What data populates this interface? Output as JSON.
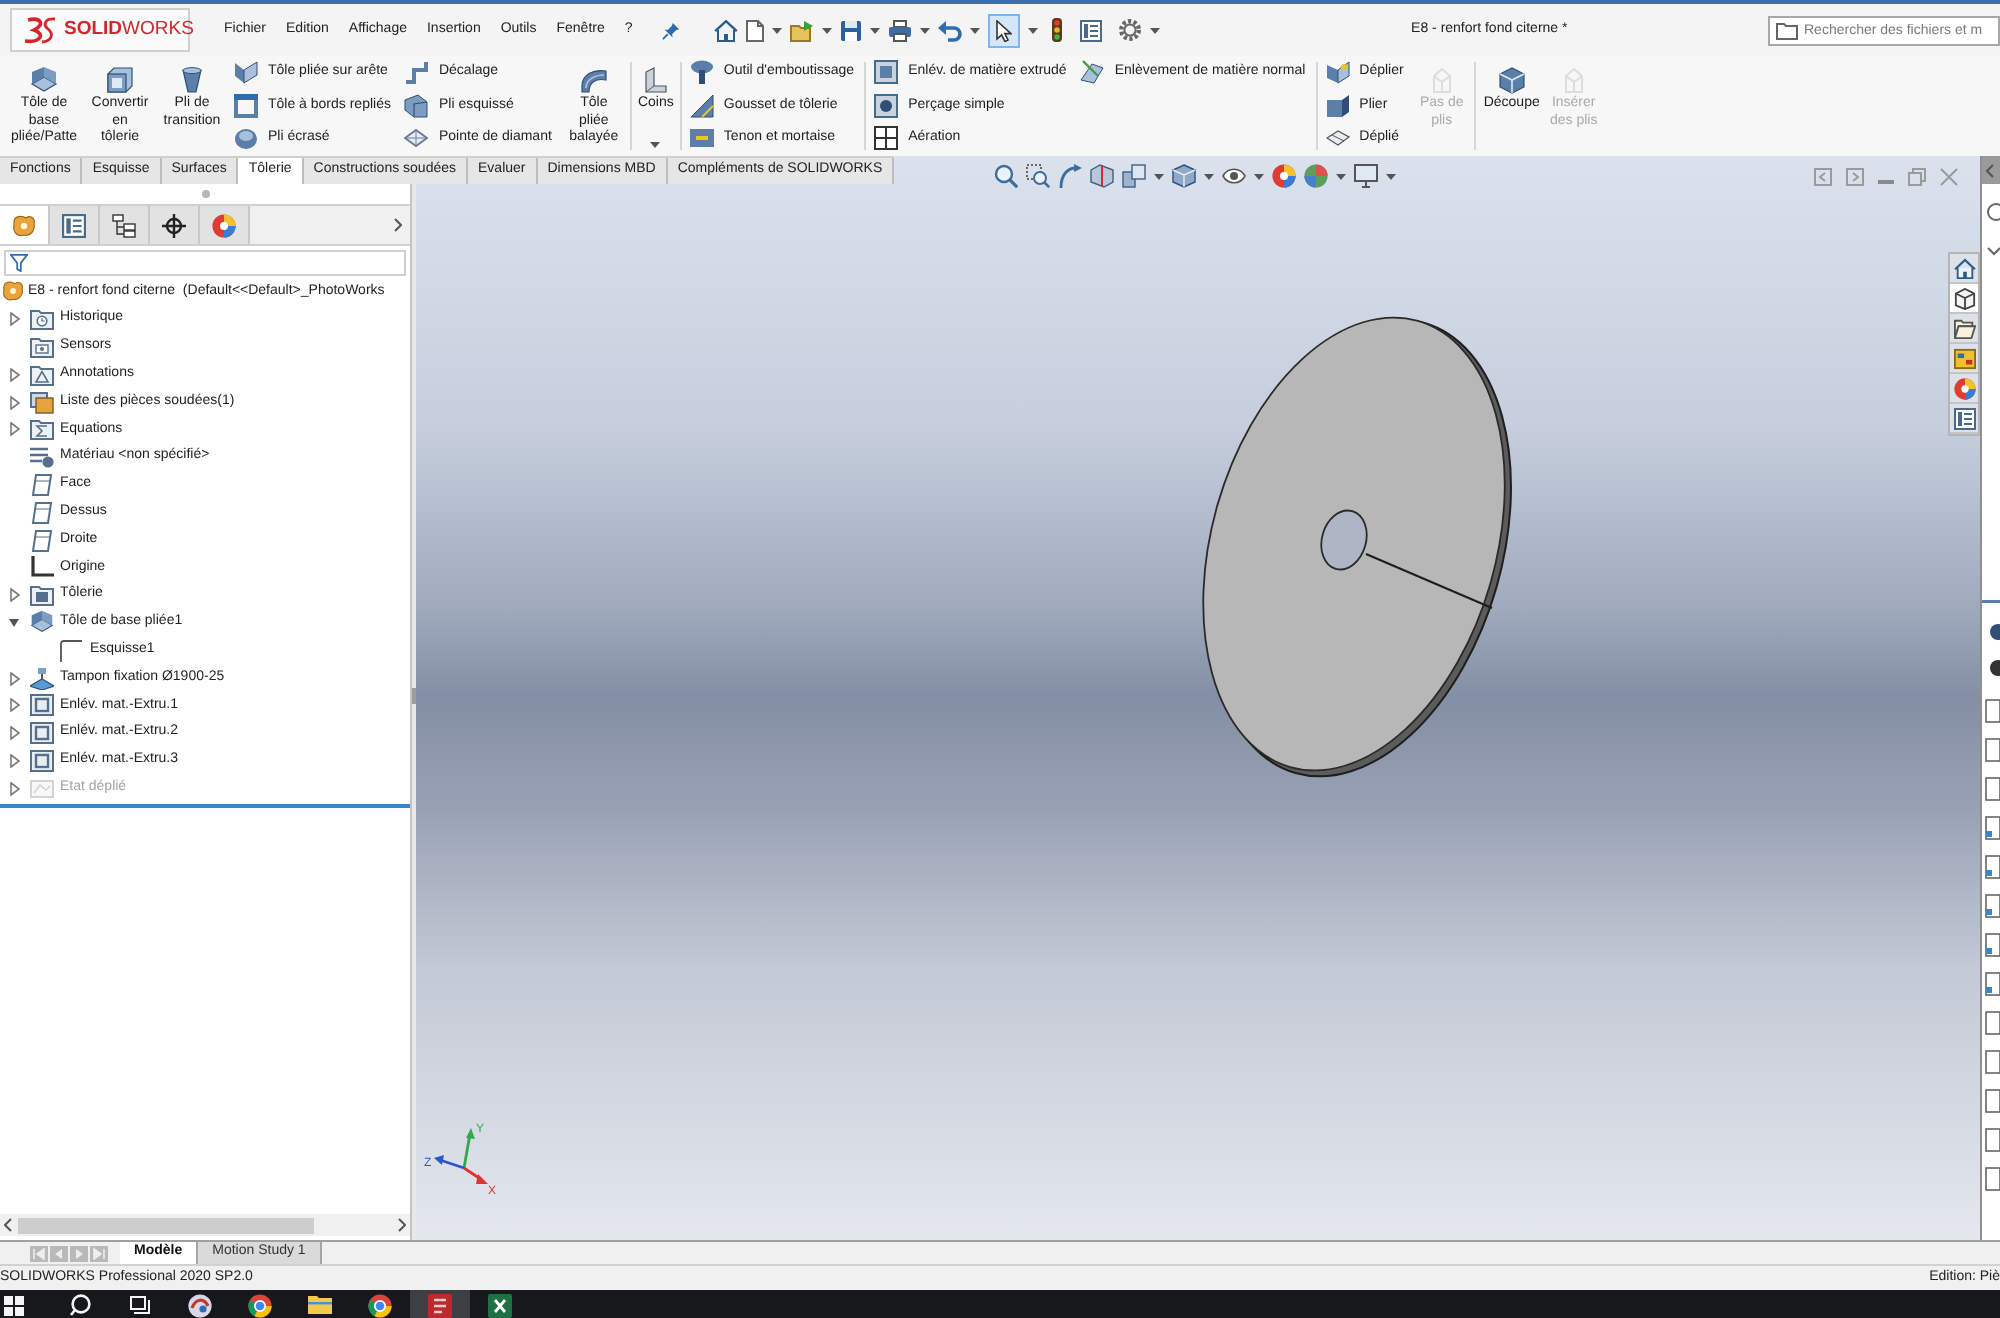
{
  "title_bar": {
    "logo": "**SOLID**WORKS",
    "menu": [
      "Fichier",
      "Edition",
      "Affichage",
      "Insertion",
      "Outils",
      "Fenêtre",
      "?"
    ],
    "select_tool": {
      "active": true
    },
    "document_title": "E8 - renfort fond citerne *",
    "search": {
      "placeholder": "Rechercher des fichiers et m"
    }
  },
  "ribbon": [
    {
      "kind": "large",
      "label": "Tôle de\nbase\npliée/Patte",
      "disabled": false,
      "dropdown": false
    },
    {
      "kind": "large",
      "label": "Convertir\nen\ntôlerie",
      "disabled": false,
      "dropdown": false
    },
    {
      "kind": "large",
      "label": "Pli de\ntransition",
      "disabled": false,
      "dropdown": false
    },
    {
      "kind": "column",
      "items": [
        {
          "label": "Tôle pliée sur arête"
        },
        {
          "label": "Tôle à bords repliés"
        },
        {
          "label": "Pli écrasé"
        }
      ]
    },
    {
      "kind": "column",
      "items": [
        {
          "label": "Décalage"
        },
        {
          "label": "Pli esquissé"
        },
        {
          "label": "Pointe de diamant"
        }
      ]
    },
    {
      "kind": "large",
      "label": "Tôle\npliée\nbalayée",
      "disabled": false,
      "dropdown": false
    },
    {
      "kind": "separator"
    },
    {
      "kind": "large",
      "label": "Coins",
      "disabled": false,
      "dropdown": true
    },
    {
      "kind": "separator"
    },
    {
      "kind": "column",
      "items": [
        {
          "label": "Outil d'emboutissage"
        },
        {
          "label": "Gousset de tôlerie"
        },
        {
          "label": "Tenon et mortaise"
        }
      ]
    },
    {
      "kind": "separator"
    },
    {
      "kind": "column",
      "items": [
        {
          "label": "Enlév. de matière extrudé"
        },
        {
          "label": "Perçage simple"
        },
        {
          "label": "Aération"
        }
      ]
    },
    {
      "kind": "column",
      "items": [
        {
          "label": "Enlèvement de matière normal"
        }
      ]
    },
    {
      "kind": "separator"
    },
    {
      "kind": "column",
      "items": [
        {
          "label": "Déplier"
        },
        {
          "label": "Plier"
        },
        {
          "label": "Déplié"
        }
      ]
    },
    {
      "kind": "large",
      "label": "Pas de\nplis",
      "disabled": true,
      "dropdown": false
    },
    {
      "kind": "separator"
    },
    {
      "kind": "large",
      "label": "Découpe",
      "disabled": false,
      "dropdown": false
    },
    {
      "kind": "large",
      "label": "Insérer\ndes plis",
      "disabled": true,
      "dropdown": false
    }
  ],
  "command_tabs": [
    {
      "label": "Fonctions",
      "selected": false
    },
    {
      "label": "Esquisse",
      "selected": false
    },
    {
      "label": "Surfaces",
      "selected": false
    },
    {
      "label": "Tôlerie",
      "selected": true
    },
    {
      "label": "Constructions soudées",
      "selected": false
    },
    {
      "label": "Evaluer",
      "selected": false
    },
    {
      "label": "Dimensions MBD",
      "selected": false
    },
    {
      "label": "Compléments de SOLIDWORKS",
      "selected": false
    }
  ],
  "feature_manager": {
    "panel_tabs": [
      {
        "selected": true
      },
      {
        "selected": false
      },
      {
        "selected": false
      },
      {
        "selected": false
      },
      {
        "selected": false
      }
    ],
    "tree": {
      "root": "E8 - renfort fond citerne  (Default<<Default>_PhotoWorks",
      "items": [
        {
          "label": "Historique",
          "expanded": false,
          "suppressed": false
        },
        {
          "label": "Sensors",
          "suppressed": false
        },
        {
          "label": "Annotations",
          "expanded": false,
          "suppressed": false
        },
        {
          "label": "Liste des pièces soudées(1)",
          "expanded": false,
          "suppressed": false
        },
        {
          "label": "Equations",
          "expanded": false,
          "suppressed": false
        },
        {
          "label": "Matériau <non spécifié>",
          "suppressed": false
        },
        {
          "label": "Face",
          "suppressed": false
        },
        {
          "label": "Dessus",
          "suppressed": false
        },
        {
          "label": "Droite",
          "suppressed": false
        },
        {
          "label": "Origine",
          "suppressed": false
        },
        {
          "label": "Tôlerie",
          "expanded": false,
          "suppressed": false
        },
        {
          "label": "Tôle de base pliée1",
          "expanded": true,
          "suppressed": false,
          "children": [
            {
              "label": "Esquisse1",
              "suppressed": false
            }
          ]
        },
        {
          "label": "Tampon fixation Ø1900-25",
          "expanded": false,
          "suppressed": false
        },
        {
          "label": "Enlév. mat.-Extru.1",
          "expanded": false,
          "suppressed": false
        },
        {
          "label": "Enlév. mat.-Extru.2",
          "expanded": false,
          "suppressed": false
        },
        {
          "label": "Enlév. mat.-Extru.3",
          "expanded": false,
          "suppressed": false
        },
        {
          "label": "Etat déplié",
          "expanded": false,
          "suppressed": true
        }
      ]
    }
  },
  "viewport": {
    "triad": {
      "x": "X",
      "y": "Y",
      "z": "Z"
    },
    "task_pane": [
      {
        "selected": false
      },
      {
        "selected": true
      },
      {
        "selected": false
      },
      {
        "selected": false
      },
      {
        "selected": false
      },
      {
        "selected": false
      }
    ]
  },
  "model_tabs": [
    {
      "label": "Modèle",
      "selected": true
    },
    {
      "label": "Motion Study 1",
      "selected": false
    }
  ],
  "status_bar": {
    "left": "SOLIDWORKS Professional 2020 SP2.0",
    "right": "Edition: Piè"
  },
  "taskbar": {
    "apps": [
      {
        "active": false
      },
      {
        "active": false
      },
      {
        "active": false
      },
      {
        "active": false
      },
      {
        "active": true
      },
      {
        "active": false
      }
    ]
  }
}
